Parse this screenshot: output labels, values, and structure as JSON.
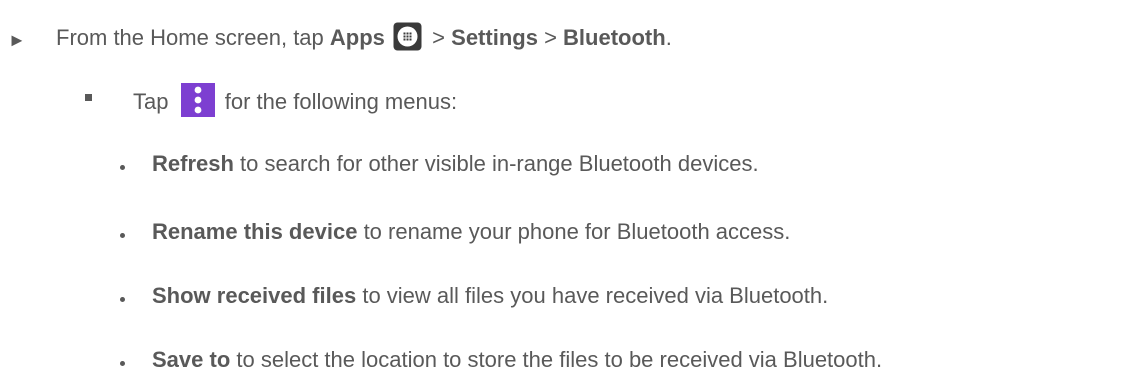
{
  "step": {
    "prefix": "From the Home screen, tap",
    "apps": "Apps",
    "sep1": ">",
    "settings": "Settings",
    "sep2": ">",
    "bluetooth": "Bluetooth",
    "end": "."
  },
  "substep": {
    "tap": "Tap",
    "suffix": "for the following menus:"
  },
  "menus": [
    {
      "label": "Refresh",
      "desc": "to search for other visible in-range Bluetooth devices."
    },
    {
      "label": "Rename this device",
      "desc": "to rename your phone for Bluetooth access."
    },
    {
      "label": "Show received files",
      "desc": "to view all files you have received via Bluetooth."
    },
    {
      "label": "Save to",
      "desc": "to select the location to store the files to be received via Bluetooth."
    }
  ],
  "icons": {
    "arrow": "play-arrow-icon",
    "apps": "apps-grid-icon",
    "menu": "more-options-icon"
  },
  "colors": {
    "text": "#595959",
    "menu_icon_bg": "#7d3fd1"
  }
}
